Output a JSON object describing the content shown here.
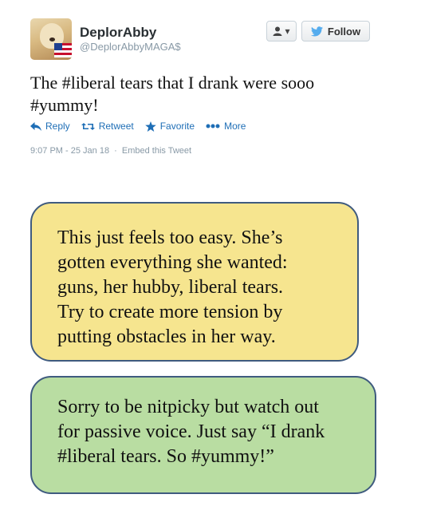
{
  "tweet": {
    "display_name": "DeplorAbby",
    "handle": "@DeplorAbbyMAGA$",
    "user_menu_icon": "user-dropdown-icon",
    "follow_label": "Follow",
    "text_line1": "The #liberal tears that I drank were sooo",
    "text_line2": "#yummy!",
    "actions": {
      "reply": "Reply",
      "retweet": "Retweet",
      "favorite": "Favorite",
      "more": "More"
    },
    "timestamp": "9:07 PM - 25 Jan 18",
    "separator": "·",
    "embed": "Embed this Tweet",
    "colors": {
      "link": "#1e6eb6",
      "muted": "#8899a6"
    }
  },
  "comments": [
    {
      "lines": [
        "This just feels too easy. She’s",
        "gotten everything she wanted:",
        "guns, her hubby, liberal tears.",
        "Try to create more tension by",
        "putting obstacles in her way."
      ],
      "background": "#f6e58f"
    },
    {
      "lines": [
        "Sorry to be nitpicky but watch out",
        "for passive voice. Just say “I drank",
        "#liberal tears. So #yummy!”"
      ],
      "background": "#b9dda2"
    }
  ]
}
